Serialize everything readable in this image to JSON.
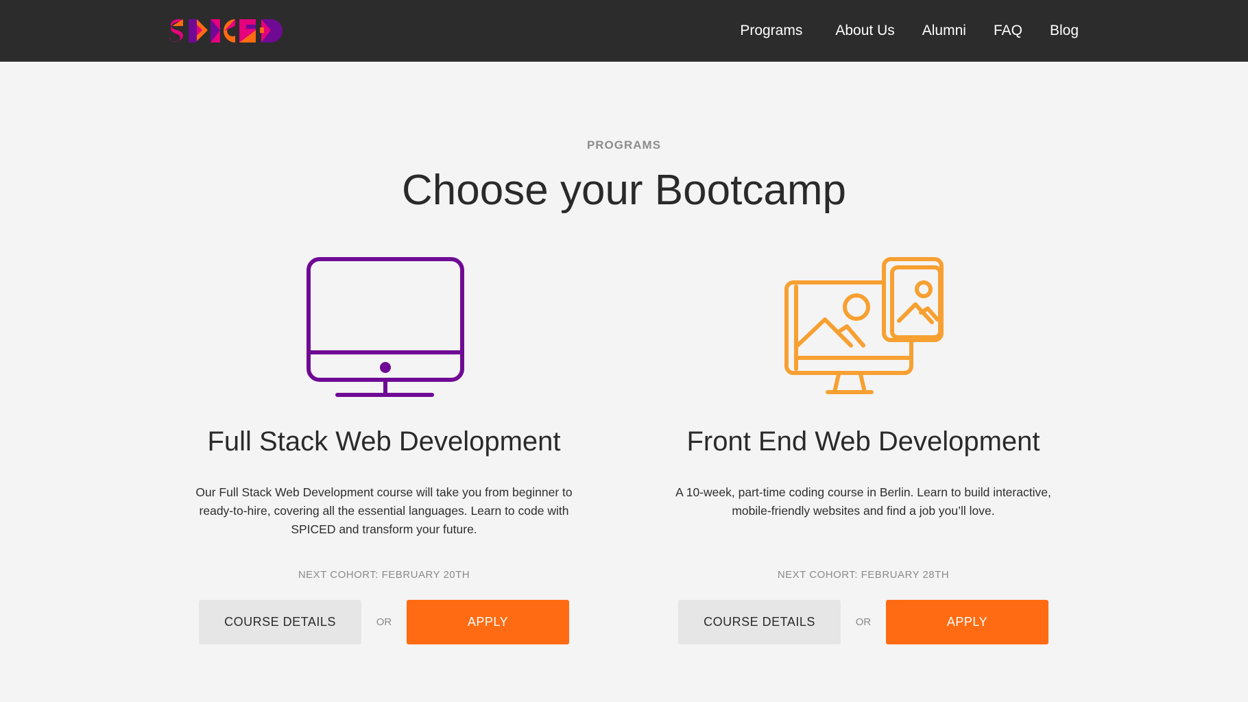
{
  "nav": {
    "logo_text": "SPICED",
    "links": [
      "Programs",
      "About Us",
      "Alumni",
      "FAQ",
      "Blog"
    ]
  },
  "hero": {
    "eyebrow": "PROGRAMS",
    "title": "Choose your Bootcamp"
  },
  "programs": [
    {
      "icon": "desktop-monitor-icon",
      "title": "Full Stack Web Development",
      "description": "Our Full Stack Web Development course will take you from beginner to ready-to-hire, covering all the essential languages. Learn to code with SPICED and transform your future.",
      "cohort": "NEXT COHORT: FEBRUARY 20TH",
      "details_label": "COURSE DETAILS",
      "or_label": "OR",
      "apply_label": "APPLY"
    },
    {
      "icon": "responsive-devices-icon",
      "title": "Front End Web Development",
      "description": "A 10-week, part-time coding course in Berlin. Learn to build interactive, mobile-friendly websites and find a job you’ll love.",
      "cohort": "NEXT COHORT: FEBRUARY 28TH",
      "details_label": "COURSE DETAILS",
      "or_label": "OR",
      "apply_label": "APPLY"
    }
  ],
  "colors": {
    "nav_bg": "#2c2c2c",
    "page_bg": "#f4f4f4",
    "purple": "#6f0a94",
    "orange_icon": "#f7a032",
    "apply_orange": "#ff6b12",
    "details_grey": "#e6e6e6"
  }
}
